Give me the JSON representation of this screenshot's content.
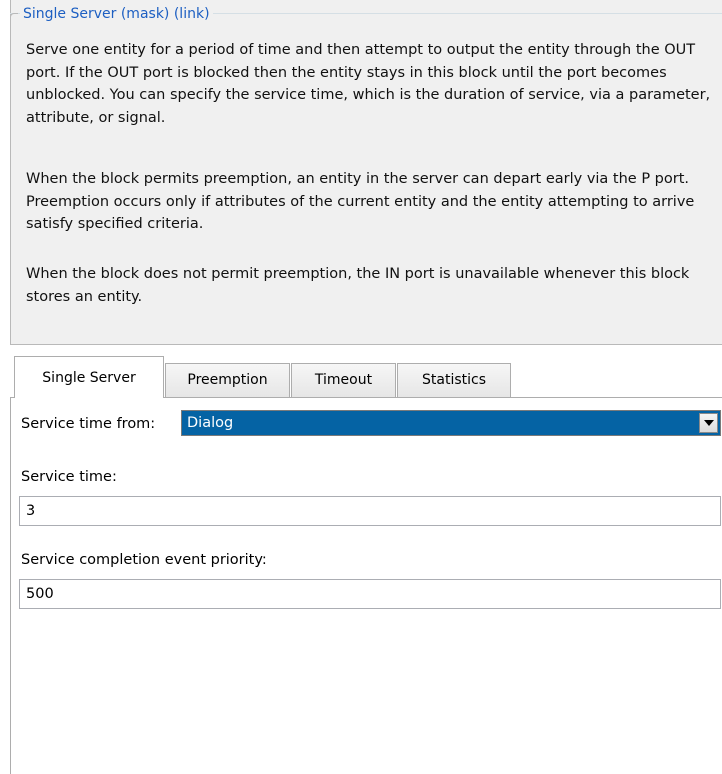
{
  "description": {
    "title": "Single Server (mask) (link)",
    "paragraphs": [
      "Serve one entity for a period of time and then attempt to output the entity through the OUT port. If the OUT port is blocked then the entity stays in this block until the port becomes unblocked. You can specify the service time, which is the duration of service, via a parameter, attribute, or signal.",
      "When the block permits preemption, an entity in the server can depart early via the P port. Preemption occurs only if attributes of the current entity and the entity attempting to arrive satisfy specified criteria.",
      "When the block does not permit preemption, the IN port is unavailable whenever this block stores an entity."
    ]
  },
  "tabs": [
    {
      "label": "Single Server",
      "active": true
    },
    {
      "label": "Preemption",
      "active": false
    },
    {
      "label": "Timeout",
      "active": false
    },
    {
      "label": "Statistics",
      "active": false
    }
  ],
  "form": {
    "service_time_from": {
      "label": "Service time from:",
      "value": "Dialog",
      "arrow_icon": "chevron-down-icon"
    },
    "service_time": {
      "label": "Service time:",
      "value": "3"
    },
    "priority": {
      "label": "Service completion event priority:",
      "value": "500"
    }
  },
  "colors": {
    "legend_text": "#1d5fc2",
    "selected_dropdown": "#0563a4",
    "panel_background": "#f0f0f0"
  }
}
